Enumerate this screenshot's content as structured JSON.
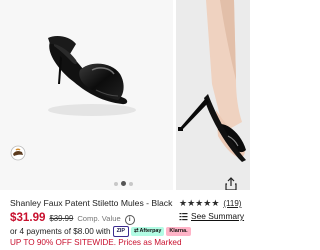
{
  "product": {
    "title": "Shanley Faux Patent Stiletto Mules - Black",
    "price": "$31.99",
    "original_price": "$39.99",
    "comp_value_label": "Comp. Value",
    "installments_text": "or 4 payments of $8.00 with",
    "promo_text": "UP TO 90% OFF SITEWIDE. Prices as Marked"
  },
  "reviews": {
    "rating": 5,
    "count": "(119)",
    "summary_label": "See Summary"
  },
  "payment_badges": {
    "zip": "ZIP",
    "afterpay": "Afterpay",
    "klarna": "Klarna."
  },
  "gallery": {
    "current_slide": 2,
    "total_slides": 3
  },
  "colors": {
    "price_red": "#c8102e",
    "stars": "#2b2b2b"
  },
  "icons": [
    "color-swatch-icon",
    "share-icon",
    "info-icon",
    "star-icon",
    "summary-icon",
    "afterpay-icon"
  ]
}
